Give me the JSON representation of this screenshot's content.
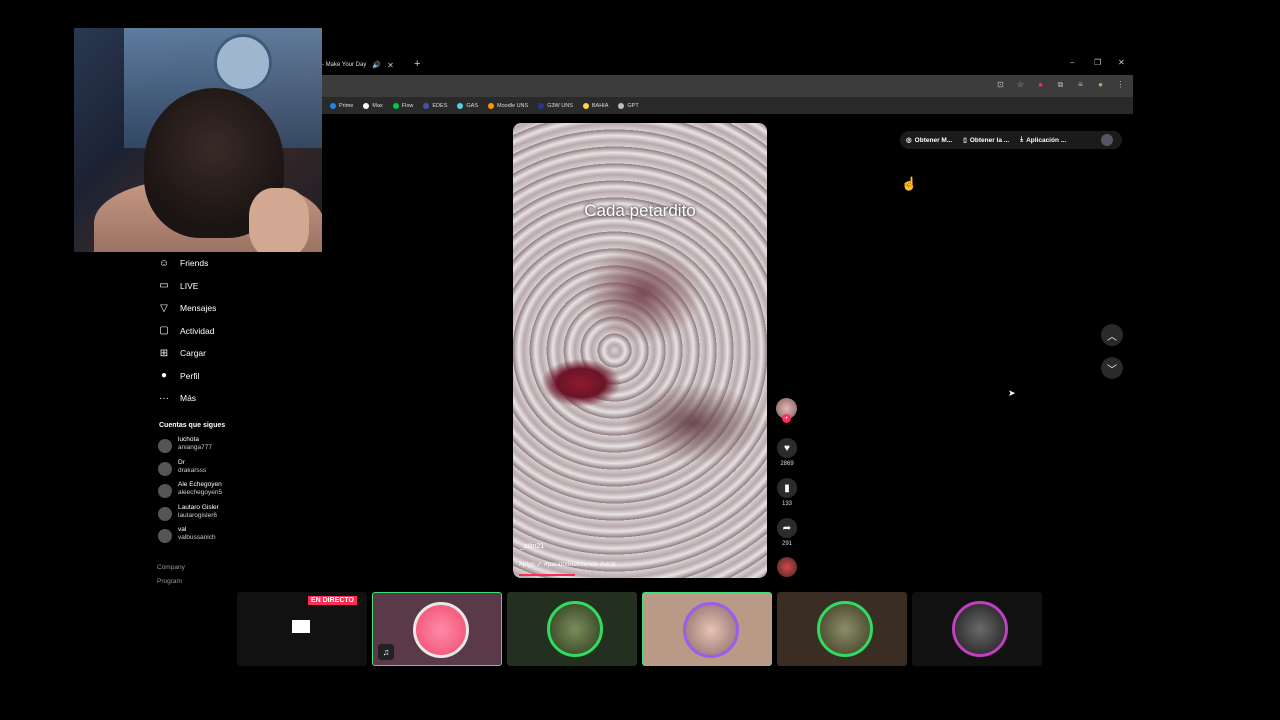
{
  "browser": {
    "tab_title": "- Make Your Day",
    "new_tab": "+",
    "win_min": "–",
    "win_max": "❐",
    "win_close": "✕",
    "bookmarks": [
      {
        "label": "Prime",
        "color": "#1e88e5"
      },
      {
        "label": "Max",
        "color": "#ffffff"
      },
      {
        "label": "Flow",
        "color": "#00c853"
      },
      {
        "label": "EDES",
        "color": "#3f51b5"
      },
      {
        "label": "GAS",
        "color": "#4dd0e1"
      },
      {
        "label": "Moodle UNS",
        "color": "#ff9800"
      },
      {
        "label": "G3W UNS",
        "color": "#283593"
      },
      {
        "label": "BAHIA",
        "color": "#fdd835"
      },
      {
        "label": "GPT",
        "color": "#bdbdbd"
      }
    ]
  },
  "nav": {
    "items": [
      {
        "label": "Friends",
        "icon": "friends-icon",
        "glyph": "☺"
      },
      {
        "label": "LIVE",
        "icon": "live-icon",
        "glyph": "▭"
      },
      {
        "label": "Mensajes",
        "icon": "messages-icon",
        "glyph": "▽"
      },
      {
        "label": "Actividad",
        "icon": "activity-icon",
        "glyph": "▢"
      },
      {
        "label": "Cargar",
        "icon": "upload-icon",
        "glyph": "⊞"
      },
      {
        "label": "Perfil",
        "icon": "profile-icon",
        "glyph": "●"
      },
      {
        "label": "Más",
        "icon": "more-icon",
        "glyph": "···"
      }
    ],
    "following_heading": "Cuentas que sigues",
    "following": [
      {
        "name": "luchota",
        "handle": "anianga777"
      },
      {
        "name": "Dr",
        "handle": "drakarsss"
      },
      {
        "name": "Ale Echegoyen",
        "handle": "aleechegoyen5"
      },
      {
        "name": "Lautaro Gisler",
        "handle": "lautarogisler6"
      },
      {
        "name": "val",
        "handle": "valbussanich"
      }
    ],
    "footer": [
      "Company",
      "Program"
    ]
  },
  "video": {
    "caption": "Cada petardito",
    "username": "_ailin21",
    "tags": "#pfyp ✓ #paratodoelmundo #viral",
    "progress": 0.22
  },
  "actions": {
    "likes": "2869",
    "saves": "133",
    "shares": "291"
  },
  "top_buttons": [
    "Obtener M...",
    "Obtener la ...",
    "Aplicación ..."
  ],
  "tray": {
    "live_badge": "EN DIRECTO"
  }
}
